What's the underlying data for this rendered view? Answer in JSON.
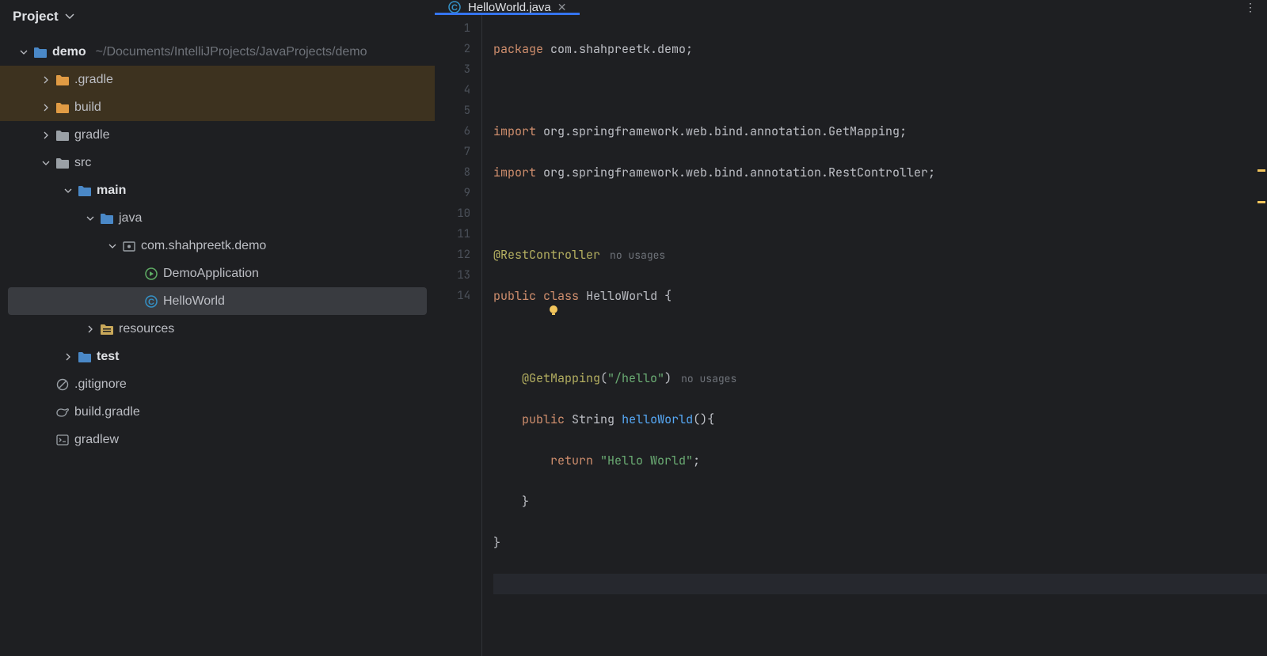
{
  "sidebar": {
    "title": "Project",
    "root": {
      "name": "demo",
      "path": "~/Documents/IntelliJProjects/JavaProjects/demo"
    },
    "nodes": {
      "gradle_dot": ".gradle",
      "build": "build",
      "gradle": "gradle",
      "src": "src",
      "main": "main",
      "java": "java",
      "pkg": "com.shahpreetk.demo",
      "demo_app": "DemoApplication",
      "hello_world": "HelloWorld",
      "resources": "resources",
      "test": "test",
      "gitignore": ".gitignore",
      "build_gradle": "build.gradle",
      "gradlew": "gradlew"
    }
  },
  "tab": {
    "title": "HelloWorld.java"
  },
  "inspections": {
    "warnings": "2"
  },
  "code": {
    "pkg_kw": "package",
    "pkg_val": "com.shahpreetk.demo;",
    "import_kw": "import",
    "imp1_pre": "org.springframework.web.bind.annotation.",
    "imp1_cls": "GetMapping",
    "imp2_pre": "org.springframework.web.bind.annotation.",
    "imp2_cls": "RestController",
    "rest_ctrl": "@RestController",
    "no_usages": "no usages",
    "public_kw": "public",
    "class_kw": "class",
    "class_name": "HelloWorld",
    "get_map": "@GetMapping",
    "get_map_arg": "\"/hello\"",
    "string_t": "String",
    "method_name": "helloWorld",
    "return_kw": "return",
    "ret_val": "\"Hello World\""
  }
}
